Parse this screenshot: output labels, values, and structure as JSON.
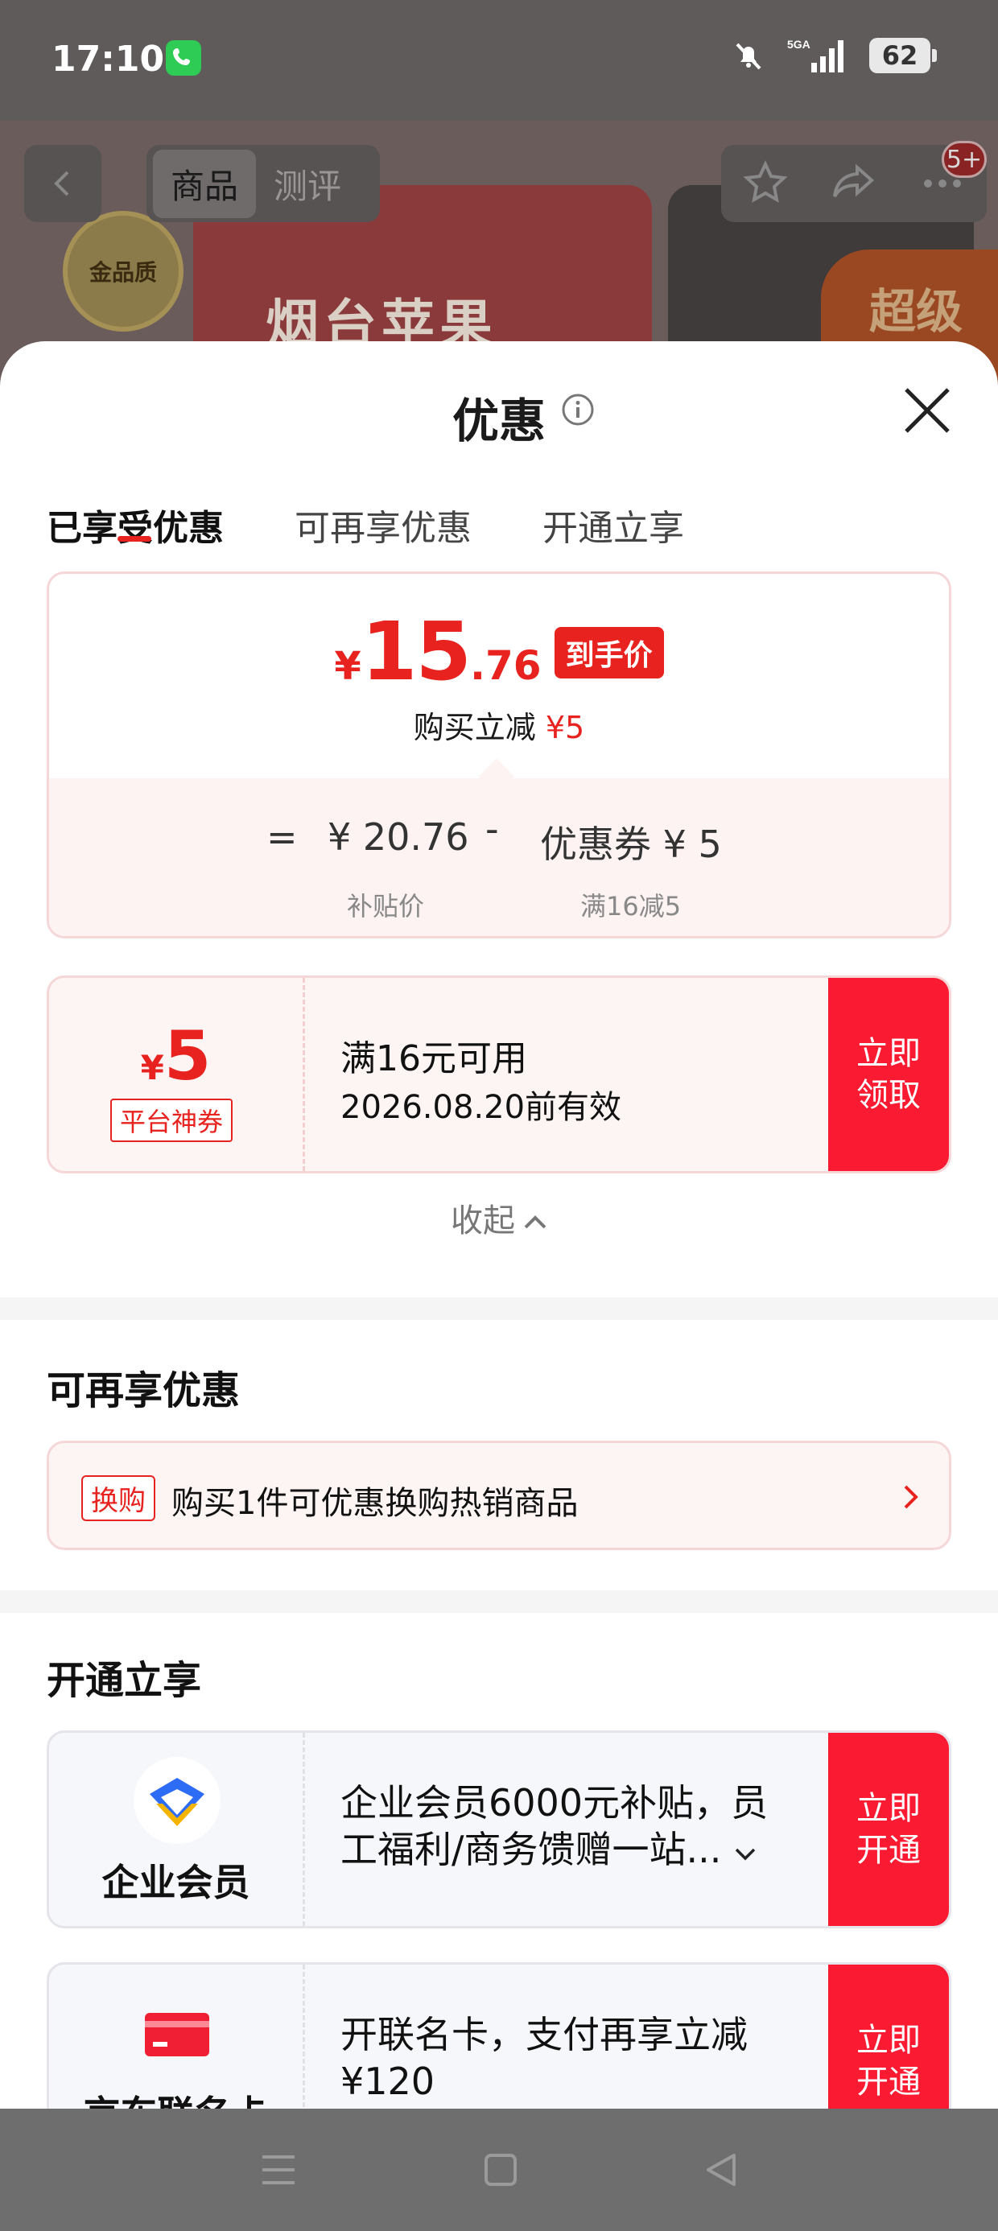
{
  "status_bar": {
    "time": "17:10",
    "network": "5GA",
    "battery": "62"
  },
  "background_page": {
    "tabs": [
      "商品",
      "测评"
    ],
    "badge_text": "金品质",
    "product_text": "烟台苹果",
    "cart_count": "5+",
    "corner_text": "超级"
  },
  "sheet": {
    "title": "优惠",
    "tabs": [
      "已享受优惠",
      "可再享优惠",
      "开通立享"
    ],
    "price_card": {
      "currency": "¥",
      "price_int": "15",
      "price_dec": ".76",
      "price_label": "到手价",
      "reduce_label": "购买立减",
      "reduce_amount": "¥5",
      "eq": "=",
      "base_price": "¥ 20.76",
      "minus": "-",
      "coupon_text": "优惠券 ¥ 5",
      "base_label": "补贴价",
      "coupon_label": "满16减5"
    },
    "coupon": {
      "currency": "¥",
      "amount": "5",
      "tag": "平台神券",
      "condition": "满16元可用",
      "validity": "2026.08.20前有效",
      "button": "立即\n领取"
    },
    "collapse_label": "收起",
    "more_section": {
      "title": "可再享优惠",
      "swap_tag": "换购",
      "swap_text": "购买1件可优惠换购热销商品"
    },
    "open_section": {
      "title": "开通立享",
      "members": [
        {
          "name": "企业会员",
          "desc": "企业会员6000元补贴，员工福利/商务馈赠一站...",
          "button": "立即\n开通"
        },
        {
          "name": "京东联名卡",
          "desc": "开联名卡，支付再享立减 ¥120",
          "button": "立即\n开通"
        }
      ]
    }
  },
  "colors": {
    "accent": "#e8231f",
    "button_red": "#fa1a31",
    "coupon_bg": "#fdf4f4"
  }
}
